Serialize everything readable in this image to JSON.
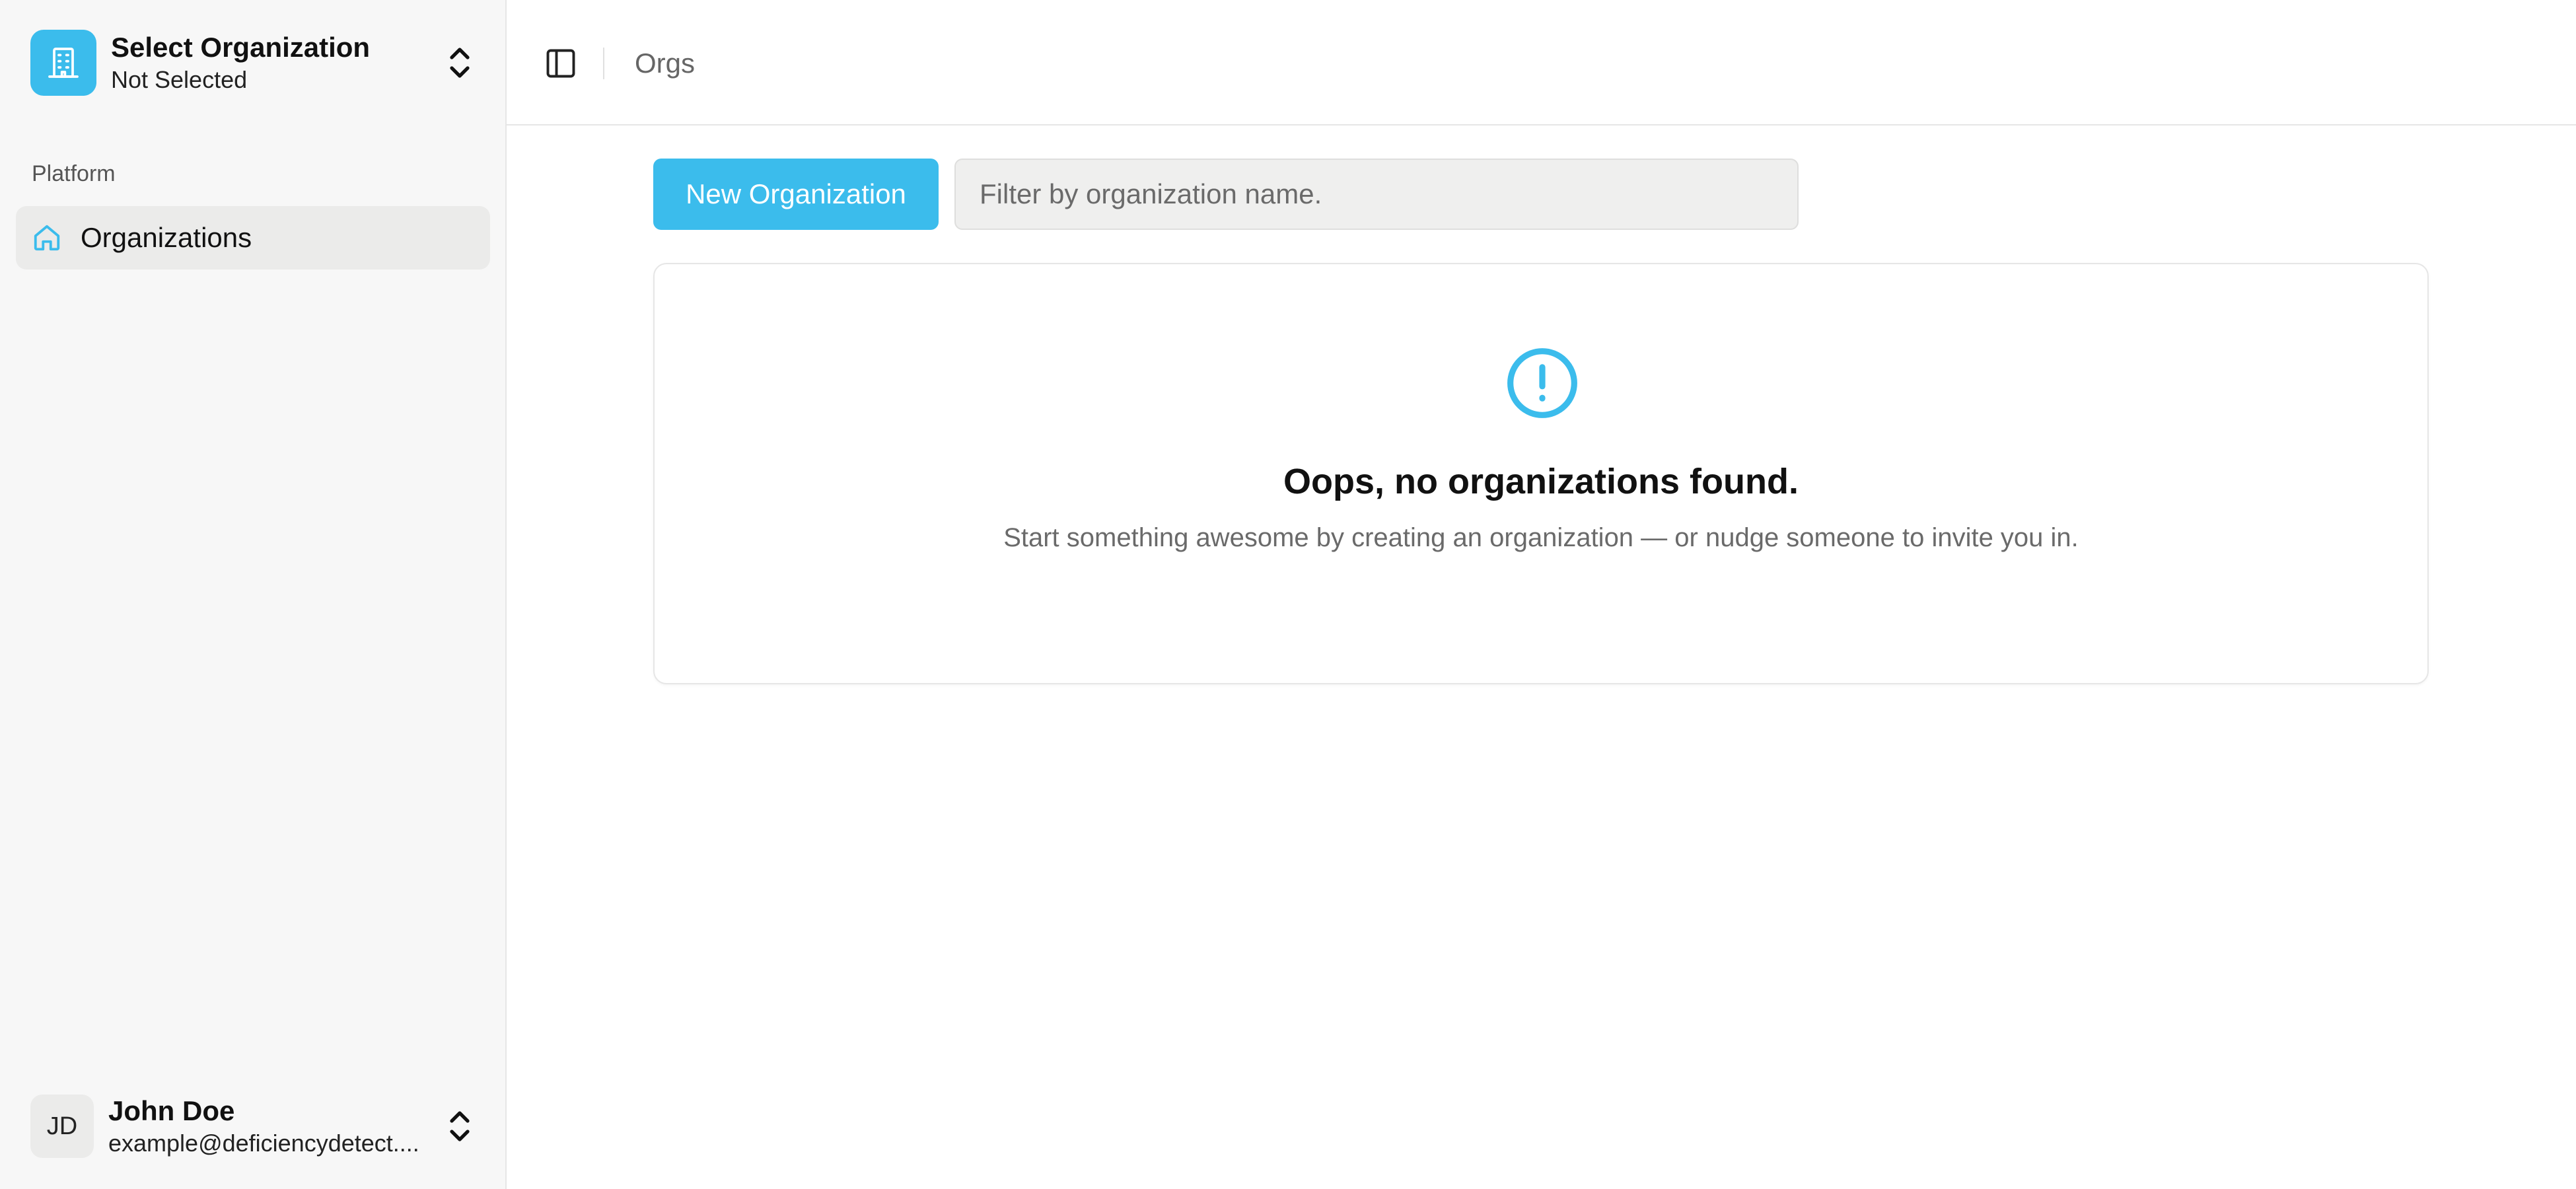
{
  "sidebar": {
    "org_switcher": {
      "title": "Select Organization",
      "subtitle": "Not Selected",
      "icon": "building-icon"
    },
    "section_label": "Platform",
    "items": [
      {
        "label": "Organizations",
        "icon": "home-icon",
        "active": true
      }
    ],
    "user": {
      "initials": "JD",
      "name": "John Doe",
      "email": "example@deficiencydetect...."
    }
  },
  "header": {
    "breadcrumb": "Orgs"
  },
  "toolbar": {
    "new_label": "New Organization",
    "filter_placeholder": "Filter by organization name.",
    "filter_value": ""
  },
  "empty_state": {
    "title": "Oops, no organizations found.",
    "description": "Start something awesome by creating an organization — or nudge someone to invite you in.",
    "icon": "alert-circle-icon"
  },
  "colors": {
    "accent": "#3bbcec",
    "sidebar_bg": "#f7f7f7",
    "active_item_bg": "#ebebea"
  }
}
